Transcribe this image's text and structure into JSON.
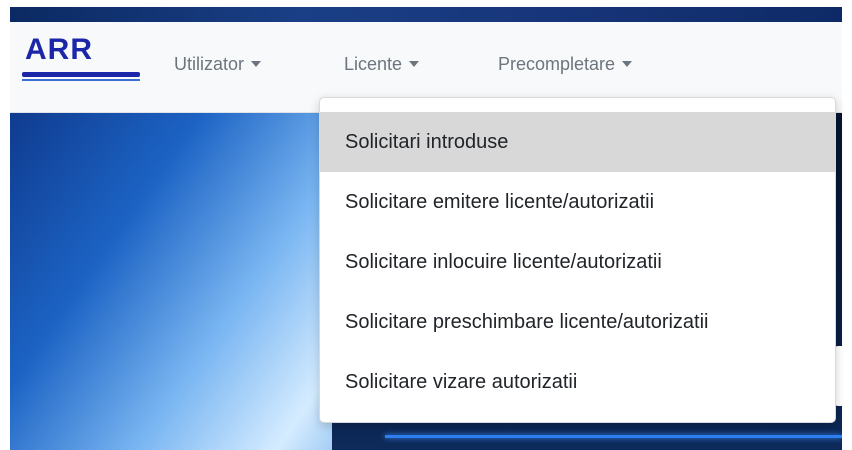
{
  "brand": {
    "logo_text": "ARR"
  },
  "nav": {
    "items": [
      {
        "label": "Utilizator"
      },
      {
        "label": "Licente"
      },
      {
        "label": "Precompletare"
      }
    ]
  },
  "dropdown": {
    "items": [
      {
        "label": "Solicitari introduse",
        "highlighted": true
      },
      {
        "label": "Solicitare emitere licente/autorizatii"
      },
      {
        "label": "Solicitare inlocuire licente/autorizatii"
      },
      {
        "label": "Solicitare preschimbare licente/autorizatii"
      },
      {
        "label": "Solicitare vizare autorizatii"
      }
    ]
  },
  "colors": {
    "brand": "#1b27a8",
    "nav_text": "#6c757d",
    "navbar_bg": "#f8f9fa",
    "top_strip": "#17357a",
    "dropdown_highlight": "#d8d8d8"
  }
}
